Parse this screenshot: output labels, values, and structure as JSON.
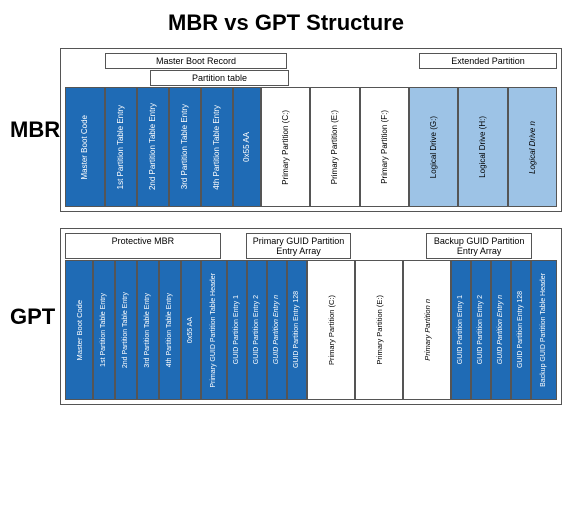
{
  "title": "MBR vs GPT Structure",
  "mbr": {
    "label": "MBR",
    "header1": {
      "left_label": "Master Boot Record",
      "left_span": 4,
      "extended_label": "Extended Partition",
      "extended_span": 3
    },
    "header2": {
      "partition_table_label": "Partition table",
      "partition_table_span": 3
    },
    "cells": [
      {
        "text": "Master Boot Code",
        "type": "blue"
      },
      {
        "text": "1st Partition Table Entry",
        "type": "blue"
      },
      {
        "text": "2nd Partition Table Entry",
        "type": "blue"
      },
      {
        "text": "3rd Partition Table Entry",
        "type": "blue"
      },
      {
        "text": "4th Partition Table Entry",
        "type": "blue"
      },
      {
        "text": "0x55 AA",
        "type": "blue"
      },
      {
        "text": "Primary Partition (C:)",
        "type": "white"
      },
      {
        "text": "Primary Partition (E:)",
        "type": "white"
      },
      {
        "text": "Primary Partition (F:)",
        "type": "white"
      },
      {
        "text": "Logical Drive (G:)",
        "type": "light-blue"
      },
      {
        "text": "Logical Drive (H:)",
        "type": "light-blue"
      },
      {
        "text": "Logical Drive n",
        "type": "light-blue-italic"
      }
    ]
  },
  "gpt": {
    "label": "GPT",
    "header1": {
      "protective_label": "Protective MBR",
      "protective_span": 6,
      "primary_guid_label": "Primary GUID Partition Entry Array",
      "primary_guid_span": 4,
      "backup_guid_label": "Backup GUID Partition Entry Array",
      "backup_guid_span": 4
    },
    "cells": [
      {
        "text": "Master Boot Code",
        "type": "blue"
      },
      {
        "text": "1st Partition Table Entry",
        "type": "blue"
      },
      {
        "text": "2nd Partition Table Entry",
        "type": "blue"
      },
      {
        "text": "3rd Partition Table Entry",
        "type": "blue"
      },
      {
        "text": "4th Partition Table Entry",
        "type": "blue"
      },
      {
        "text": "0x55 AA",
        "type": "blue"
      },
      {
        "text": "Primary GUID Partition Table Header",
        "type": "blue"
      },
      {
        "text": "GUID Partition Entry 1",
        "type": "blue"
      },
      {
        "text": "GUID Partition Entry 2",
        "type": "blue"
      },
      {
        "text": "GUID Partition Entry n",
        "type": "blue-italic"
      },
      {
        "text": "GUID Partition Entry 128",
        "type": "blue"
      },
      {
        "text": "Primary Partition (C:)",
        "type": "white"
      },
      {
        "text": "Primary Partition (E:)",
        "type": "white"
      },
      {
        "text": "Primary Partition n",
        "type": "white-italic"
      },
      {
        "text": "GUID Partition Entry 1",
        "type": "blue"
      },
      {
        "text": "GUID Partition Entry 2",
        "type": "blue"
      },
      {
        "text": "GUID Partition Entry n",
        "type": "blue-italic"
      },
      {
        "text": "GUID Partition Entry 128",
        "type": "blue"
      },
      {
        "text": "Backup GUID Partition Table Header",
        "type": "blue"
      }
    ]
  }
}
